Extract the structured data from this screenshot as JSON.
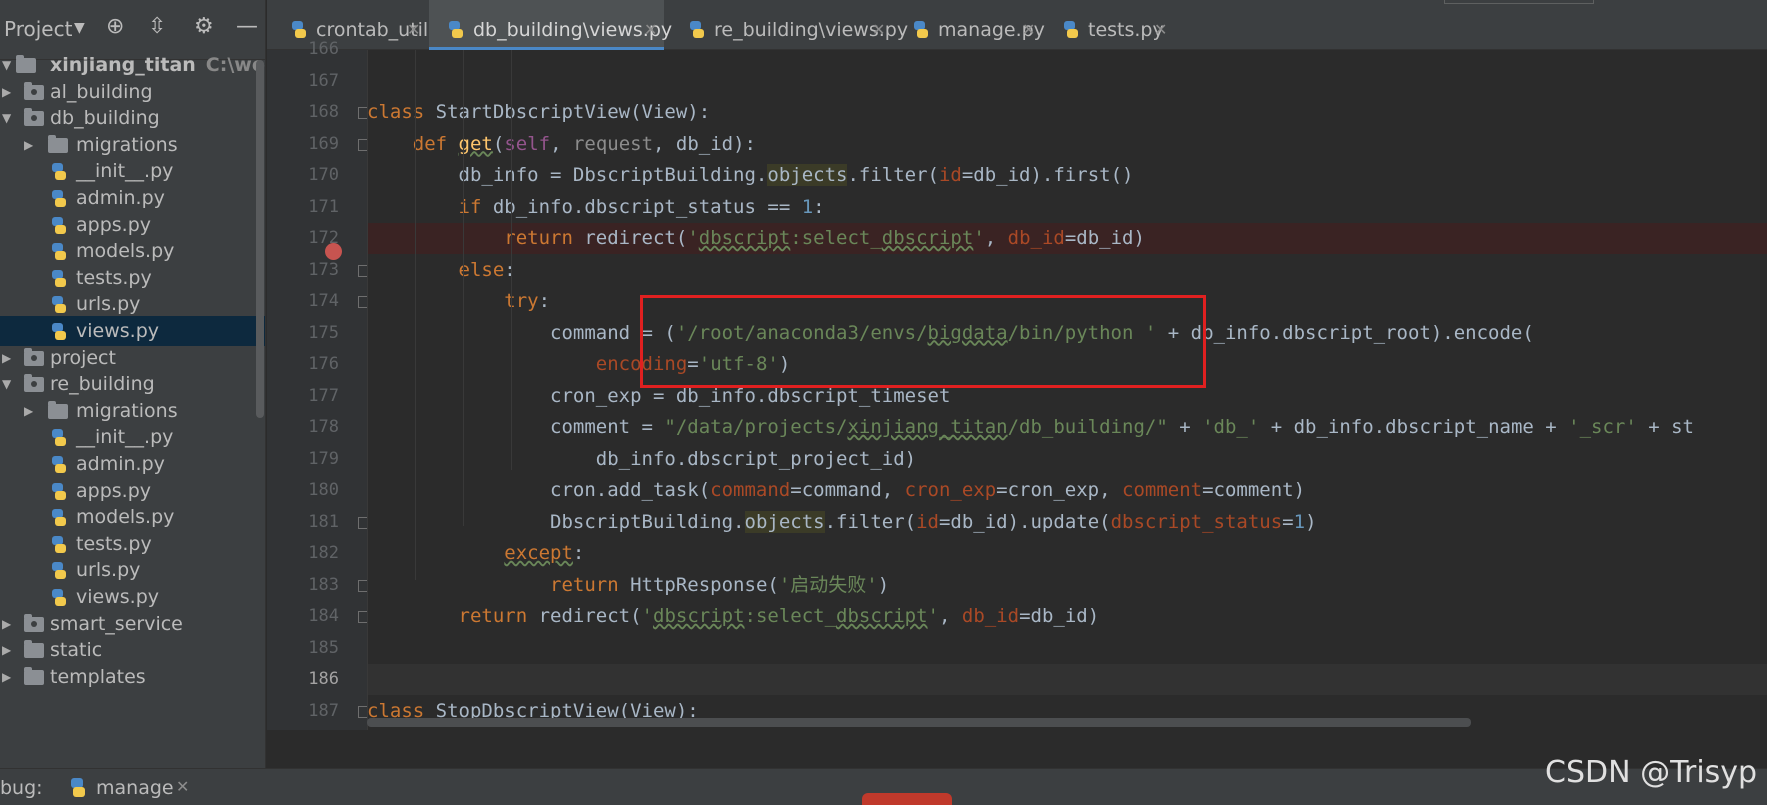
{
  "project_panel": {
    "title": "Project",
    "tree": [
      {
        "label": "xinjiang_titan",
        "hint": "C:\\work\\Pych",
        "kind": "root",
        "depth": 0,
        "open": true
      },
      {
        "label": "al_building",
        "kind": "module",
        "depth": 1,
        "open": false
      },
      {
        "label": "db_building",
        "kind": "module",
        "depth": 1,
        "open": true
      },
      {
        "label": "migrations",
        "kind": "folder",
        "depth": 2,
        "open": false
      },
      {
        "label": "__init__.py",
        "kind": "py",
        "depth": 2
      },
      {
        "label": "admin.py",
        "kind": "py",
        "depth": 2
      },
      {
        "label": "apps.py",
        "kind": "py",
        "depth": 2
      },
      {
        "label": "models.py",
        "kind": "py",
        "depth": 2
      },
      {
        "label": "tests.py",
        "kind": "py",
        "depth": 2
      },
      {
        "label": "urls.py",
        "kind": "py",
        "depth": 2
      },
      {
        "label": "views.py",
        "kind": "py",
        "depth": 2,
        "selected": true
      },
      {
        "label": "project",
        "kind": "module",
        "depth": 1,
        "open": false
      },
      {
        "label": "re_building",
        "kind": "module",
        "depth": 1,
        "open": true
      },
      {
        "label": "migrations",
        "kind": "folder",
        "depth": 2,
        "open": false
      },
      {
        "label": "__init__.py",
        "kind": "py",
        "depth": 2
      },
      {
        "label": "admin.py",
        "kind": "py",
        "depth": 2
      },
      {
        "label": "apps.py",
        "kind": "py",
        "depth": 2
      },
      {
        "label": "models.py",
        "kind": "py",
        "depth": 2
      },
      {
        "label": "tests.py",
        "kind": "py",
        "depth": 2
      },
      {
        "label": "urls.py",
        "kind": "py",
        "depth": 2
      },
      {
        "label": "views.py",
        "kind": "py",
        "depth": 2
      },
      {
        "label": "smart_service",
        "kind": "module",
        "depth": 1,
        "open": false
      },
      {
        "label": "static",
        "kind": "folder",
        "depth": 1,
        "open": false
      },
      {
        "label": "templates",
        "kind": "folder",
        "depth": 1,
        "open": false
      }
    ]
  },
  "tabs": [
    {
      "label": "crontab_utils.py",
      "active": false
    },
    {
      "label": "db_building\\views.py",
      "active": true
    },
    {
      "label": "re_building\\views.py",
      "active": false
    },
    {
      "label": "manage.py",
      "active": false
    },
    {
      "label": "tests.py",
      "active": false
    }
  ],
  "editor": {
    "current_line": 186,
    "breakpoint_line": 172,
    "lines": [
      {
        "n": 166,
        "html": ""
      },
      {
        "n": 167,
        "html": ""
      },
      {
        "n": 168,
        "html": "<span class='kw'>class </span>StartDbscriptView(View):"
      },
      {
        "n": 169,
        "html": "    <span class='kw'>def </span><span class='fn u'>get</span>(<span class='slf'>self</span>, <span class='grey'>request</span>, db_id):"
      },
      {
        "n": 170,
        "html": "        db_info = DbscriptBuilding.<span class='hl'>objects</span>.filter(<span class='prm'>id</span>=db_id).first()"
      },
      {
        "n": 171,
        "html": "        <span class='kw'>if </span>db_info.dbscript_status == <span class='num'>1</span>:"
      },
      {
        "n": 172,
        "html": "            <span class='kw'>return </span>redirect(<span class='str'>'<span class=\"u\">dbscript</span>:select_<span class=\"u\">dbscript</span>'</span>, <span class='prm'>db_id</span>=db_id)"
      },
      {
        "n": 173,
        "html": "        <span class='kw'>else</span>:"
      },
      {
        "n": 174,
        "html": "            <span class='kw'>try</span>:"
      },
      {
        "n": 175,
        "html": "                command = (<span class='str'>'/root/anaconda3/envs/<span class=\"u\">bigdata</span>/bin/python '</span> + db_info.dbscript_root).encode("
      },
      {
        "n": 176,
        "html": "                    <span class='prm'>encoding</span>=<span class='str'>'utf-8'</span>)"
      },
      {
        "n": 177,
        "html": "                cron_exp = db_info.dbscript_timeset"
      },
      {
        "n": 178,
        "html": "                comment = <span class='str'>\"/data/projects/<span class=\"u\">xinjiang_titan</span>/db_building/\"</span> + <span class='str'>'db_'</span> + db_info.dbscript_name + <span class='str'>'_scr'</span> + st"
      },
      {
        "n": 179,
        "html": "                    db_info.dbscript_project_id)"
      },
      {
        "n": 180,
        "html": "                cron.add_task(<span class='prm'>command</span>=command, <span class='prm'>cron_exp</span>=cron_exp, <span class='prm'>comment</span>=comment)"
      },
      {
        "n": 181,
        "html": "                DbscriptBuilding.<span class='hl'>objects</span>.filter(<span class='prm'>id</span>=db_id).update(<span class='prm'>dbscript_status</span>=<span class='num'>1</span>)"
      },
      {
        "n": 182,
        "html": "            <span class='kw u'>except</span>:"
      },
      {
        "n": 183,
        "html": "                <span class='kw'>return </span>HttpResponse(<span class='str'>'启动失败'</span>)"
      },
      {
        "n": 184,
        "html": "        <span class='kw'>return </span>redirect(<span class='str'>'<span class=\"u\">dbscript</span>:select_<span class=\"u\">dbscript</span>'</span>, <span class='prm'>db_id</span>=db_id)"
      },
      {
        "n": 185,
        "html": ""
      },
      {
        "n": 186,
        "html": ""
      },
      {
        "n": 187,
        "html": "<span class='kw'>class </span>StopDbscriptView(View):"
      }
    ]
  },
  "debug_bar": {
    "label": "bug:",
    "tab_label": "manage"
  },
  "watermark": "CSDN @Trisyp"
}
